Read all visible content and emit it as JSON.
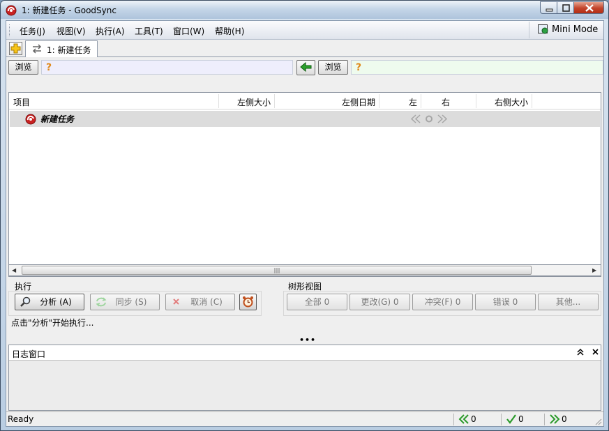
{
  "window": {
    "title": "1: 新建任务 - GoodSync"
  },
  "menubar": {
    "items": [
      "任务(J)",
      "视图(V)",
      "执行(A)",
      "工具(T)",
      "窗口(W)",
      "帮助(H)"
    ],
    "mini_mode_label": "Mini Mode"
  },
  "tabs": [
    {
      "label": "1:  新建任务"
    }
  ],
  "paths": {
    "left_browse": "浏览",
    "right_browse": "浏览",
    "left_status": "?",
    "right_status": "?",
    "left_color": "#eeeefc",
    "right_color": "#eefbee"
  },
  "grid": {
    "columns": [
      "项目",
      "左侧大小",
      "左侧日期",
      "左",
      "右",
      "右侧大小"
    ],
    "rows": [
      {
        "name": "新建任务"
      }
    ]
  },
  "execute": {
    "label": "执行",
    "analyze": "分析 (A)",
    "sync": "同步 (S)",
    "cancel": "取消 (C)"
  },
  "tree_view": {
    "label": "树形视图",
    "buttons": [
      "全部 0",
      "更改(G) 0",
      "冲突(F) 0",
      "错误 0",
      "其他..."
    ]
  },
  "status_message": "点击\"分析\"开始执行...",
  "log": {
    "title": "日志窗口"
  },
  "statusbar": {
    "ready": "Ready",
    "left_count": "0",
    "check_count": "0",
    "right_count": "0"
  }
}
